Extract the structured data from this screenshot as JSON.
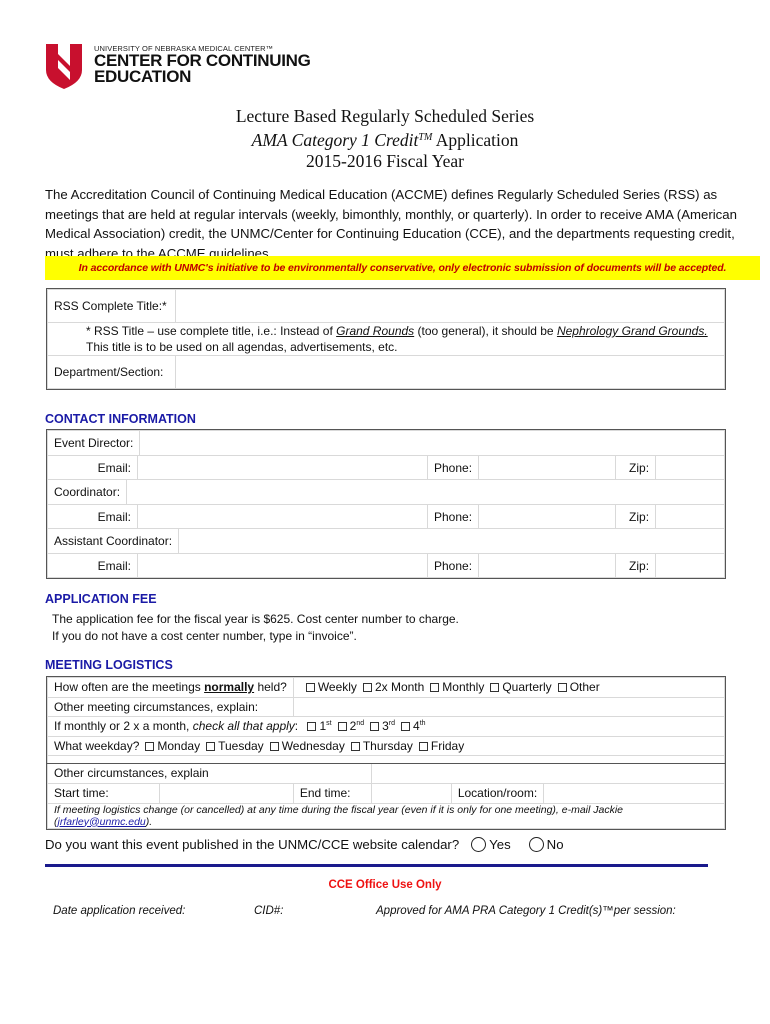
{
  "logo": {
    "icon": "unmc-shield-n-icon",
    "brand_color": "#c8102e",
    "line1": "UNIVERSITY OF NEBRASKA MEDICAL CENTER™",
    "line2": "CENTER FOR CONTINUING",
    "line3": "EDUCATION"
  },
  "title": {
    "line1": "Lecture Based Regularly Scheduled Series",
    "line2_italic": "AMA Category 1 Credit",
    "line2_tm": "TM",
    "line2_rest": " Application",
    "line3": "2015-2016 Fiscal Year"
  },
  "intro": "The Accreditation Council of Continuing Medical Education (ACCME) defines Regularly Scheduled Series (RSS) as meetings that are held at regular intervals (weekly, bimonthly, monthly, or quarterly). In order to receive AMA (American Medical Association) credit, the UNMC/Center for Continuing Education (CCE), and the departments requesting credit, must adhere to the ACCME guidelines.",
  "notice": "In accordance with UNMC's initiative to be environmentally conservative, only electronic submission of documents will be accepted.",
  "rss": {
    "title_label": "RSS Complete Title:*",
    "title_value": "",
    "note_pre": "* RSS Title – use complete title, i.e.: Instead of ",
    "note_ex1": "Grand Rounds",
    "note_mid": "  (too general), it should be ",
    "note_ex2": "Nephrology Grand Grounds.",
    "note_line2": "This title is to be used on all agendas, advertisements, etc.",
    "dept_label": "Department/Section:",
    "dept_value": ""
  },
  "contact": {
    "heading": "CONTACT INFORMATION",
    "email_label": "Email:",
    "phone_label": "Phone:",
    "zip_label": "Zip:",
    "people": [
      {
        "role": "Event Director:",
        "name": "",
        "email": "",
        "phone": "",
        "zip": ""
      },
      {
        "role": "Coordinator:",
        "name": "",
        "email": "",
        "phone": "",
        "zip": ""
      },
      {
        "role": "Assistant Coordinator:",
        "name": "",
        "email": "",
        "phone": "",
        "zip": ""
      }
    ]
  },
  "fee": {
    "heading": "APPLICATION FEE",
    "line1": "The application fee for the fiscal year is $625. Cost center number to charge.",
    "line2": "If you do not have a cost center number, type in “invoice”."
  },
  "logistics": {
    "heading": "MEETING LOGISTICS",
    "freq_label_pre": "How often are the meetings ",
    "freq_label_bold": "normally",
    "freq_label_post": " held?",
    "freq_options": [
      "Weekly",
      "2x Month",
      "Monthly",
      "Quarterly",
      "Other"
    ],
    "other_label": "Other meeting circumstances, explain:",
    "monthly_label_pre": "If monthly or 2 x a month, ",
    "monthly_label_it": "check all that apply",
    "monthly_label_post": ":",
    "week_options": [
      {
        "n": "1",
        "sup": "st"
      },
      {
        "n": "2",
        "sup": "nd"
      },
      {
        "n": "3",
        "sup": "rd"
      },
      {
        "n": "4",
        "sup": "th"
      }
    ],
    "weekday_label": "What weekday?",
    "weekday_options": [
      "Monday",
      "Tuesday",
      "Wednesday",
      "Thursday",
      "Friday"
    ],
    "other2_label": "Other circumstances, explain",
    "start_label": "Start time:",
    "end_label": "End time:",
    "location_label": "Location/room:",
    "note_pre": "If meeting logistics change (or cancelled) at any time during the fiscal year (even if it is only for one meeting), e-mail Jackie (",
    "note_email": "jrfarley@unmc.edu",
    "note_post": ")."
  },
  "publish": {
    "question": "Do you want this event published in the UNMC/CCE website calendar?",
    "yes": "Yes",
    "no": "No"
  },
  "office": {
    "heading": "CCE Office Use Only",
    "date_label": "Date application received:",
    "cid_label": "CID#:",
    "approved_label": "Approved for AMA PRA Category 1 Credit(s)™per session:"
  }
}
